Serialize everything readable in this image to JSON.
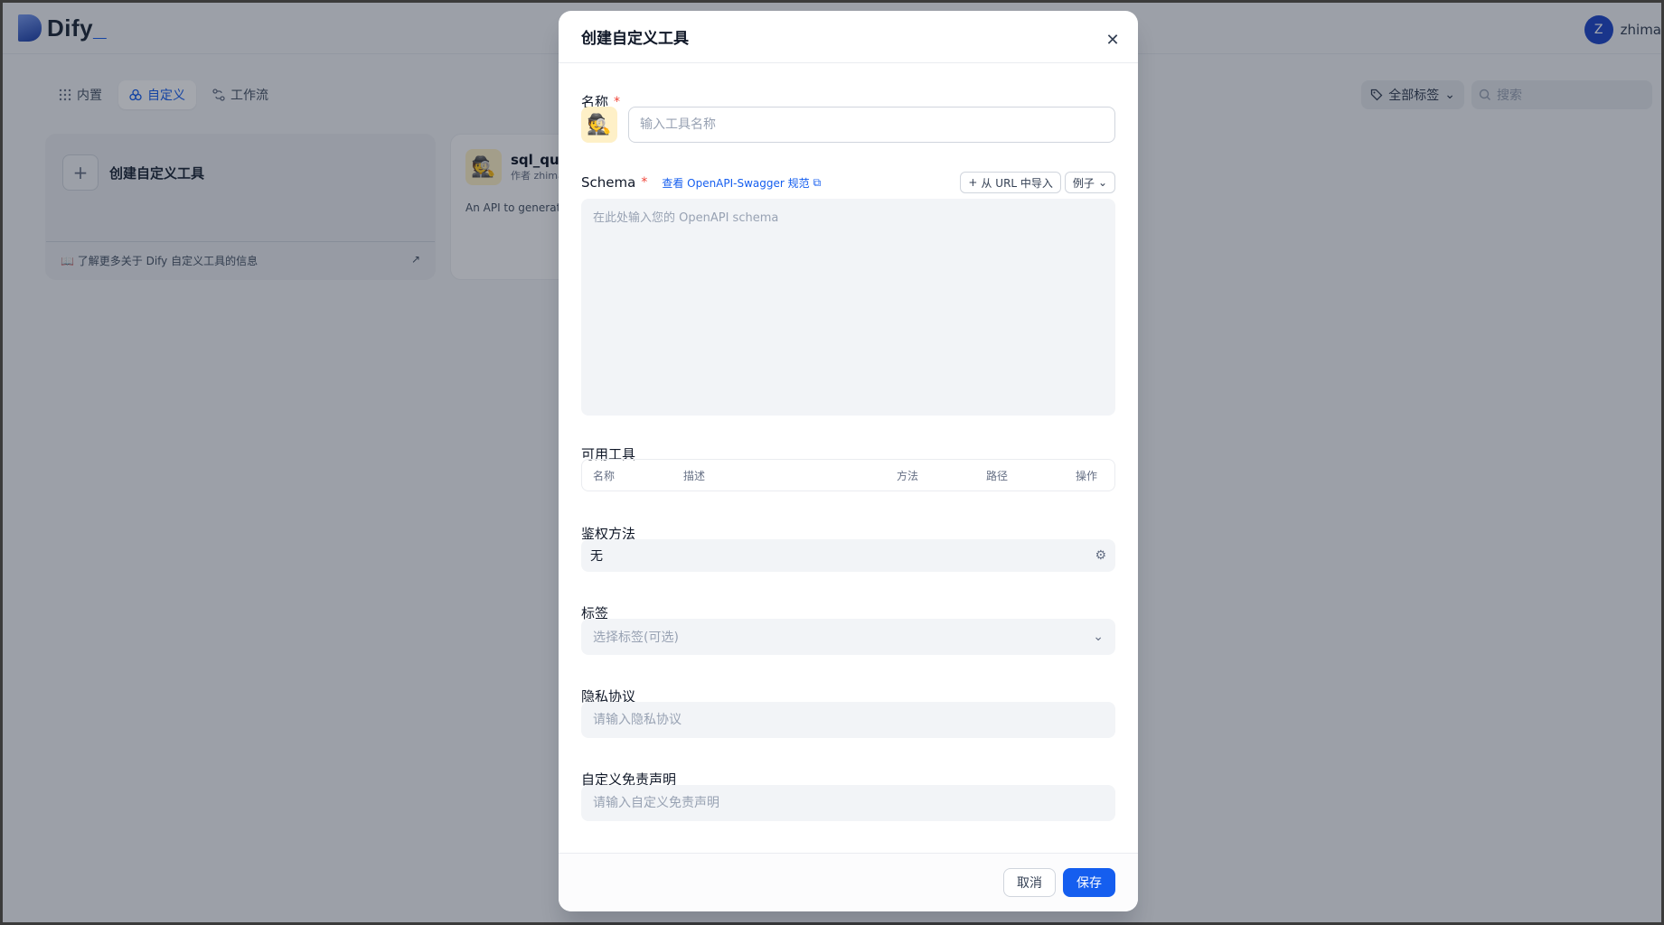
{
  "app": {
    "logo_text": "Dify",
    "user": {
      "initial": "Z",
      "name": "zhima"
    },
    "tabs": [
      {
        "label": "内置",
        "icon": "grid-icon"
      },
      {
        "label": "自定义",
        "icon": "custom-icon"
      },
      {
        "label": "工作流",
        "icon": "workflow-icon"
      }
    ],
    "tag_filter_label": "全部标签",
    "search_placeholder": "搜索",
    "create_card": {
      "title": "创建自定义工具",
      "footer_text": "了解更多关于 Dify 自定义工具的信息"
    },
    "tool_card": {
      "name": "sql_quer",
      "author": "作者 zhima",
      "description": "An API to generate user input."
    }
  },
  "modal": {
    "title": "创建自定义工具",
    "name_label": "名称",
    "required_mark": "*",
    "name_placeholder": "输入工具名称",
    "emoji": "🕵️",
    "schema_label": "Schema",
    "swagger_link": "查看 OpenAPI-Swagger 规范",
    "import_url_button": "从 URL 中导入",
    "example_button": "例子",
    "schema_placeholder": "在此处输入您的 OpenAPI schema",
    "tools_label": "可用工具",
    "tools_columns": [
      "名称",
      "描述",
      "方法",
      "路径",
      "操作"
    ],
    "auth_label": "鉴权方法",
    "auth_value": "无",
    "tags_label": "标签",
    "tags_placeholder": "选择标签(可选)",
    "privacy_label": "隐私协议",
    "privacy_placeholder": "请输入隐私协议",
    "disclaimer_label": "自定义免责声明",
    "disclaimer_placeholder": "请输入自定义免责声明",
    "cancel_label": "取消",
    "save_label": "保存"
  }
}
